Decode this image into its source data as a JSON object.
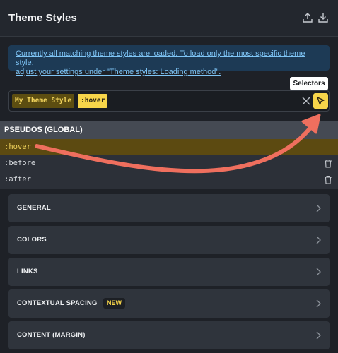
{
  "header": {
    "title": "Theme Styles",
    "icons": [
      "upload-icon",
      "download-icon"
    ]
  },
  "notice": {
    "line1": "Currently all matching theme styles are loaded. To load only the most specific theme style,",
    "line2": "adjust your settings under \"Theme styles: Loading method\"."
  },
  "tooltip": {
    "label": "Selectors"
  },
  "selector": {
    "style_name": "My Theme Style",
    "state": ":hover"
  },
  "pseudos": {
    "heading": "PSEUDOS (GLOBAL)",
    "items": [
      {
        "label": ":hover",
        "active": true
      },
      {
        "label": ":before",
        "active": false
      },
      {
        "label": ":after",
        "active": false
      }
    ]
  },
  "sections": [
    {
      "label": "GENERAL"
    },
    {
      "label": "COLORS"
    },
    {
      "label": "LINKS"
    },
    {
      "label": "CONTEXTUAL SPACING",
      "badge": "NEW"
    },
    {
      "label": "CONTENT (MARGIN)"
    }
  ],
  "colors": {
    "accent": "#f7d54a",
    "arrow": "#ef6f5e",
    "link": "#7ec4f5",
    "background": "#1e2127"
  }
}
